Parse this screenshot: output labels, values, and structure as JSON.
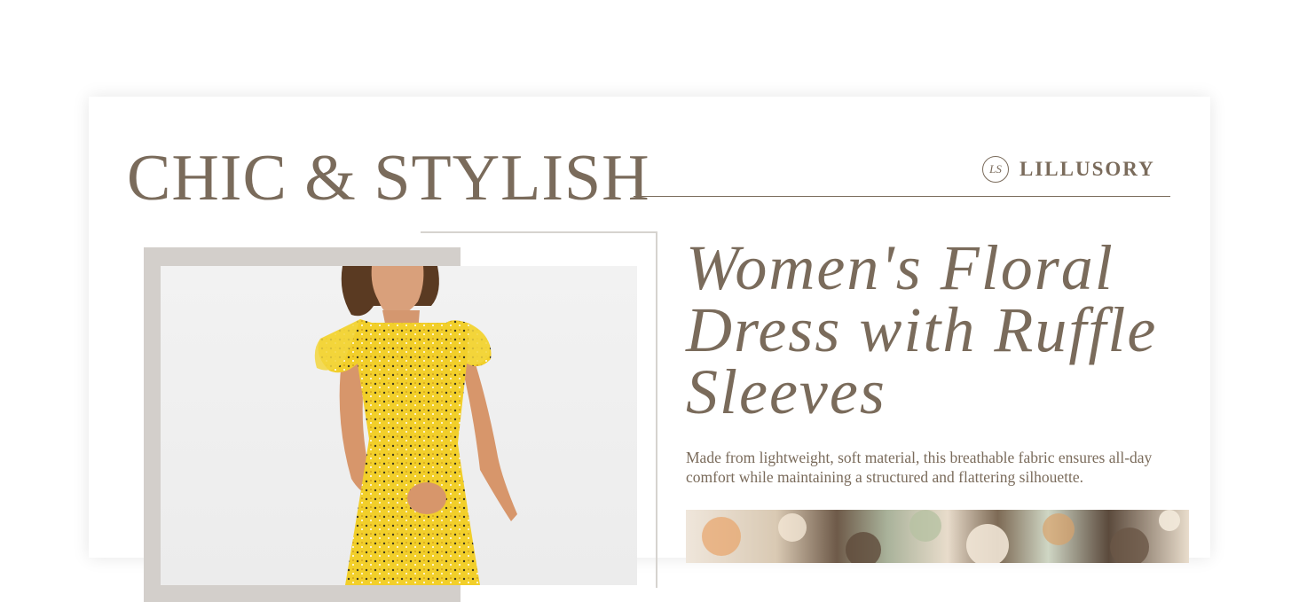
{
  "header": {
    "headline": "CHIC & STYLISH",
    "brand": {
      "mark": "LS",
      "name": "LILLUSORY"
    }
  },
  "product": {
    "title": "Women's Floral Dress with Ruffle Sleeves",
    "description": "Made from lightweight, soft material, this breathable fabric ensures all-day comfort while maintaining a structured and flattering silhouette."
  },
  "colors": {
    "accent": "#7a6b5b",
    "frame_block": "#d3cfcb",
    "dress_yellow": "#f2cf2a"
  }
}
